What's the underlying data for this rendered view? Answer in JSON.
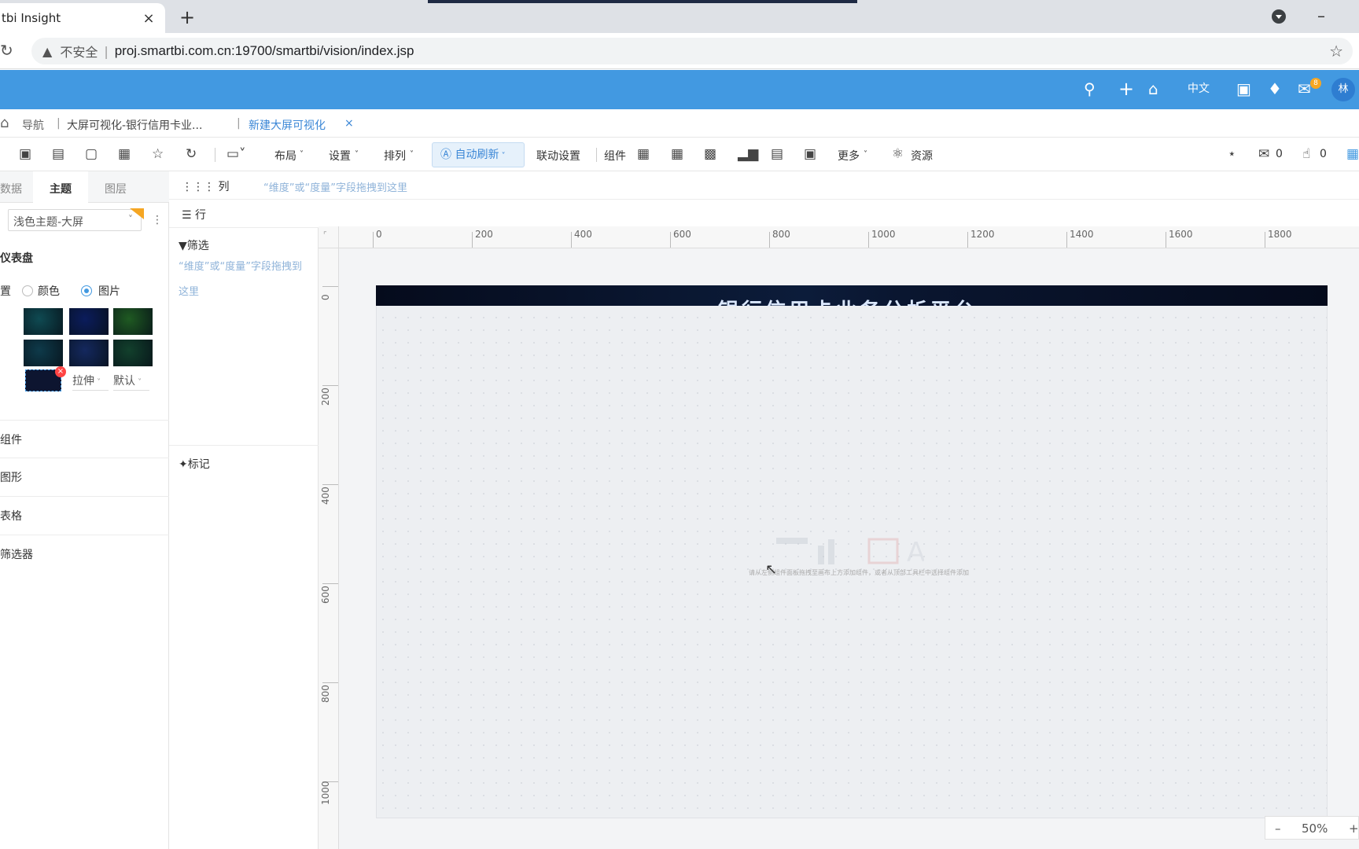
{
  "browser": {
    "tab_title": "tbi Insight",
    "tab_close": "×",
    "new_tab": "+",
    "minimize": "–",
    "reload": "C",
    "insecure_label": "不安全",
    "separator": "|",
    "url": "proj.smartbi.com.cn:19700/smartbi/vision/index.jsp"
  },
  "appbar": {
    "lang": "中文",
    "message_count": "8",
    "avatar_letter": "林"
  },
  "crumbs": {
    "nav": "导航",
    "tab1": "大屏可视化-银行信用卡业...",
    "tab2": "新建大屏可视化",
    "close": "×"
  },
  "toolbar": {
    "layout": "布局",
    "settings": "设置",
    "arrange": "排列",
    "auto_refresh": "自动刷新",
    "linkage": "联动设置",
    "components": "组件",
    "more": "更多",
    "resources": "资源",
    "comment_count": "0",
    "like_count": "0"
  },
  "left_panel": {
    "tabs": [
      "数据",
      "主题",
      "图层"
    ],
    "theme_value": "浅色主题-大屏",
    "section": "仪表盘",
    "bg_label": "置",
    "radio_color": "颜色",
    "radio_image": "图片",
    "fit_value": "拉伸",
    "align_value": "默认",
    "groups": [
      "组件",
      "图形",
      "表格",
      "筛选器"
    ],
    "swatch_colors": [
      "#0f4a52",
      "#0b1c5c",
      "#1f5a22",
      "#0e3a4a",
      "#14285e",
      "#12402c"
    ]
  },
  "shelves": {
    "column_label": "列",
    "row_label": "行",
    "column_hint": "“维度”或“度量”字段拖拽到这里",
    "filter_title": "筛选",
    "filter_hint": "“维度”或“度量”字段拖拽到这里",
    "mark_title": "标记"
  },
  "ruler": {
    "top": [
      "0",
      "200",
      "400",
      "600",
      "800",
      "1000",
      "1200",
      "1400",
      "1600",
      "1800"
    ],
    "left": [
      "0",
      "200",
      "400",
      "600",
      "800",
      "1000"
    ]
  },
  "canvas": {
    "banner_title": "银行信用卡业务分析平台",
    "placeholder_text": "请从左侧组件面板拖拽至画布上方添加组件，或者从顶部工具栏中选择组件添加"
  },
  "zoom": {
    "minus": "–",
    "value": "50%",
    "plus": "+"
  }
}
